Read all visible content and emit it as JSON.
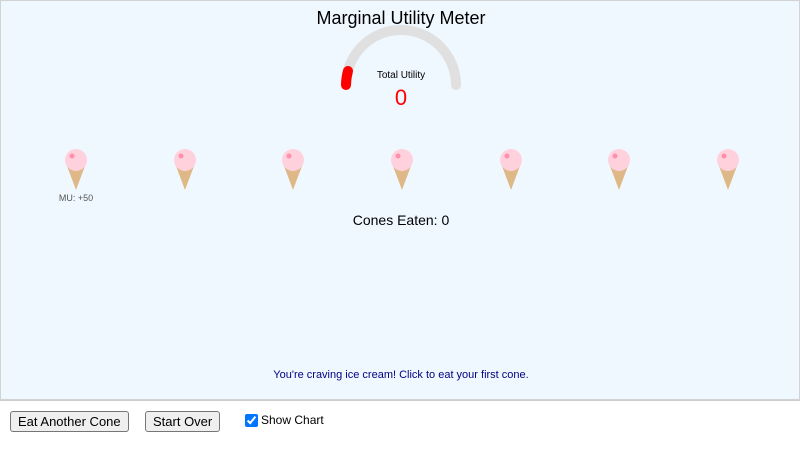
{
  "title": "Marginal Utility Meter",
  "gauge": {
    "label": "Total Utility",
    "value": "0",
    "level": 0,
    "track_color": "#e0e0e0",
    "fill_color": "#ff0000"
  },
  "cones": {
    "count": 7,
    "items": [
      {
        "id": 1,
        "mu_label": "MU: +50"
      },
      {
        "id": 2,
        "mu_label": ""
      },
      {
        "id": 3,
        "mu_label": ""
      },
      {
        "id": 4,
        "mu_label": ""
      },
      {
        "id": 5,
        "mu_label": ""
      },
      {
        "id": 6,
        "mu_label": ""
      },
      {
        "id": 7,
        "mu_label": ""
      }
    ],
    "scoop_color": "#ffd1dc",
    "cone_color": "#deb887"
  },
  "cones_eaten_text": "Cones Eaten: 0",
  "message": "You're craving ice cream! Click to eat your first cone.",
  "controls": {
    "eat_label": "Eat Another Cone",
    "reset_label": "Start Over",
    "show_chart_label": "Show Chart",
    "show_chart_checked": true
  }
}
